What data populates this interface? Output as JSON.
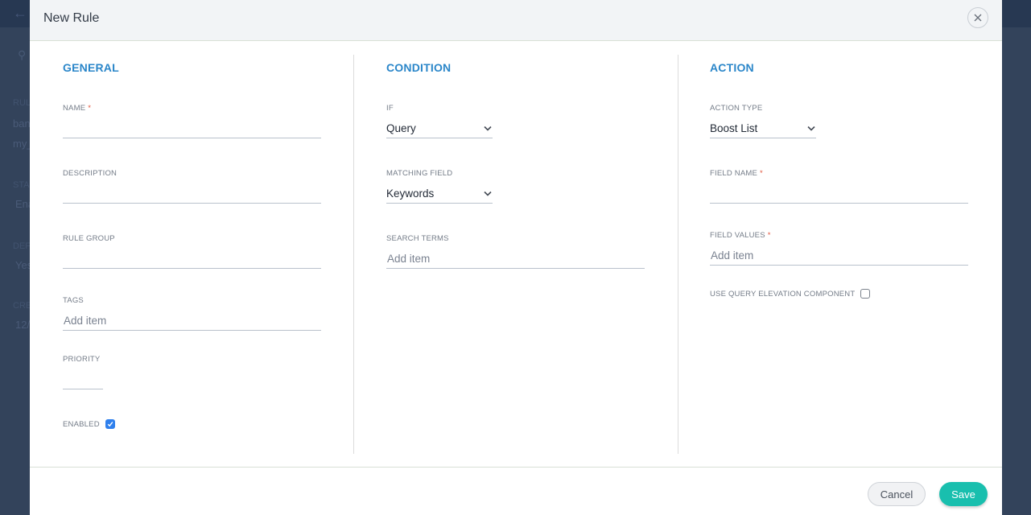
{
  "background": {
    "fragments": [
      "RUL",
      "ban",
      "my_",
      "STA",
      "Ena",
      "DEF",
      "Yes",
      "CRE",
      "12/"
    ]
  },
  "modal": {
    "title": "New Rule",
    "close_icon": "close-icon"
  },
  "general": {
    "title": "GENERAL",
    "name_label": "NAME",
    "name_value": "",
    "description_label": "DESCRIPTION",
    "description_value": "",
    "rule_group_label": "RULE GROUP",
    "rule_group_value": "",
    "tags_label": "TAGS",
    "tags_placeholder": "Add item",
    "priority_label": "PRIORITY",
    "priority_value": "",
    "enabled_label": "ENABLED",
    "enabled": true
  },
  "condition": {
    "title": "CONDITION",
    "if_label": "IF",
    "if_value": "Query",
    "matching_field_label": "MATCHING FIELD",
    "matching_field_value": "Keywords",
    "search_terms_label": "SEARCH TERMS",
    "search_terms_placeholder": "Add item"
  },
  "action": {
    "title": "ACTION",
    "action_type_label": "ACTION TYPE",
    "action_type_value": "Boost List",
    "field_name_label": "FIELD NAME",
    "field_name_value": "",
    "field_values_label": "FIELD VALUES",
    "field_values_placeholder": "Add item",
    "use_qec_label": "USE QUERY ELEVATION COMPONENT",
    "use_qec": false
  },
  "required_marker": "*",
  "footer": {
    "cancel_label": "Cancel",
    "save_label": "Save"
  },
  "colors": {
    "accent": "#2a86c9",
    "save": "#19bfae",
    "required": "#e2563e",
    "checkbox_on": "#2f80ed"
  }
}
